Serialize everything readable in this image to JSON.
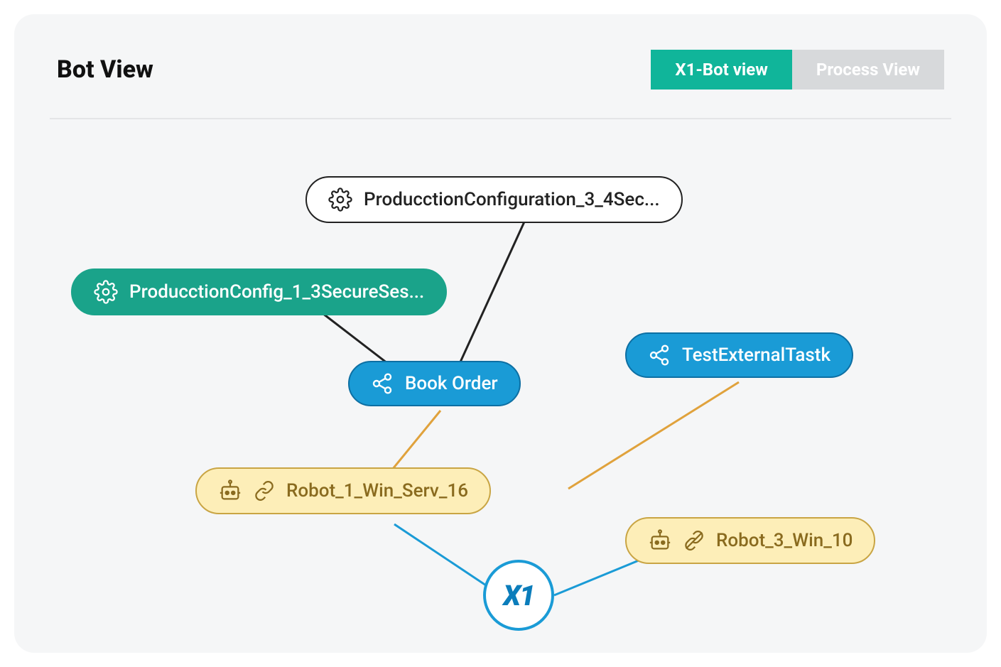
{
  "header": {
    "title": "Bot View",
    "tabs": [
      {
        "label": "X1-Bot view",
        "active": true
      },
      {
        "label": "Process View",
        "active": false
      }
    ]
  },
  "nodes": {
    "config_white": {
      "label": "ProducctionConfiguration_3_4Sec..."
    },
    "config_teal": {
      "label": "ProducctionConfig_1_3SecureSes..."
    },
    "book_order": {
      "label": "Book Order"
    },
    "external_task": {
      "label": "TestExternalTastk"
    },
    "robot1": {
      "label": "Robot_1_Win_Serv_16"
    },
    "robot3": {
      "label": "Robot_3_Win_10"
    }
  },
  "hub": {
    "label": "X1"
  },
  "colors": {
    "teal": "#10b59a",
    "blue": "#1a9bd6",
    "yellow_fill": "#fdeeb8",
    "yellow_border": "#c9a544",
    "line_black": "#222",
    "line_orange": "#e0a23c",
    "line_blue": "#1a9bd6"
  }
}
